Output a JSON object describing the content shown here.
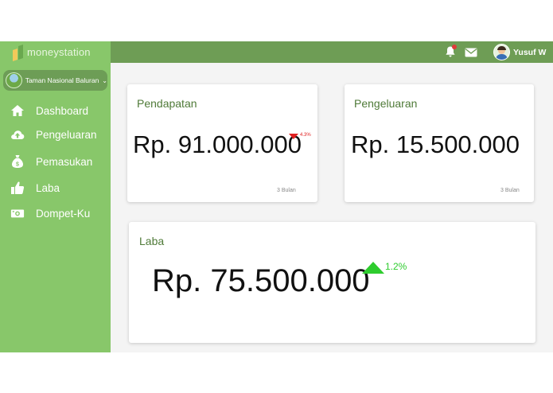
{
  "colors": {
    "sidebar": "#88c76a",
    "topbar": "#6e9d55",
    "card_title": "#4f7a38",
    "negative": "#e02020",
    "positive": "#2ecc2e"
  },
  "brand": {
    "name": "moneystation"
  },
  "org_selector": {
    "label": "Taman Nasional Baluran"
  },
  "sidebar": {
    "items": [
      {
        "label": "Dashboard",
        "icon": "home-icon"
      },
      {
        "label": "Pengeluaran",
        "icon": "cloud-upload-icon"
      },
      {
        "label": "Pemasukan",
        "icon": "money-bag-icon"
      },
      {
        "label": "Laba",
        "icon": "thumbs-up-icon"
      },
      {
        "label": "Dompet-Ku",
        "icon": "wallet-icon"
      }
    ]
  },
  "topbar": {
    "notification_icon": "bell-icon",
    "message_icon": "envelope-icon",
    "user_name": "Yusuf W"
  },
  "cards": {
    "pendapatan": {
      "title": "Pendapatan",
      "amount": "Rp. 91.000.000",
      "change": "4.3%",
      "trend": "down",
      "period": "3 Bulan"
    },
    "pengeluaran": {
      "title": "Pengeluaran",
      "amount": "Rp. 15.500.000",
      "period": "3 Bulan"
    },
    "laba": {
      "title": "Laba",
      "amount": "Rp. 75.500.000",
      "change": "1.2%",
      "trend": "up"
    }
  }
}
